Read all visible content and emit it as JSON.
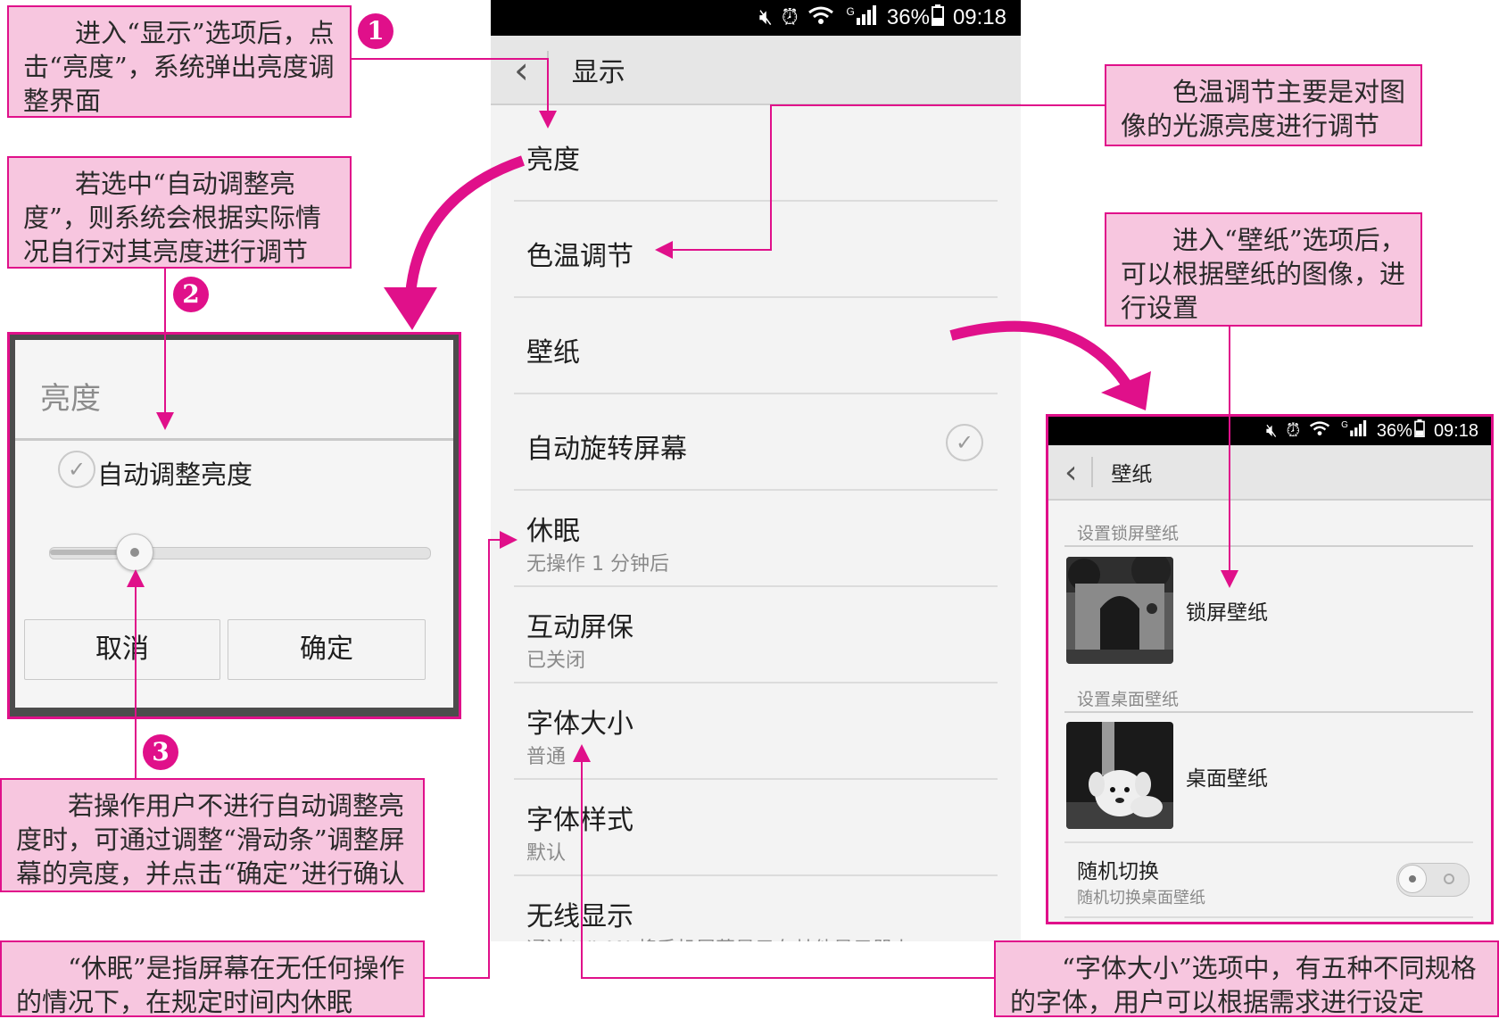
{
  "main_screen": {
    "status_bar": {
      "battery": "36%",
      "time": "09:18",
      "network": "G"
    },
    "title": "显示",
    "items": [
      {
        "title": "亮度"
      },
      {
        "title": "色温调节"
      },
      {
        "title": "壁纸"
      },
      {
        "title": "自动旋转屏幕",
        "checked": true
      },
      {
        "title": "休眠",
        "subtitle": "无操作 1 分钟后"
      },
      {
        "title": "互动屏保",
        "subtitle": "已关闭"
      },
      {
        "title": "字体大小",
        "subtitle": "普通"
      },
      {
        "title": "字体样式",
        "subtitle": "默认"
      },
      {
        "title": "无线显示",
        "subtitle": "通过 WLAN 将手机屏幕显示在其他显示器上"
      }
    ]
  },
  "brightness_dialog": {
    "title": "亮度",
    "auto_label": "自动调整亮度",
    "auto_checked": true,
    "slider_level": 0.22,
    "cancel_label": "取消",
    "confirm_label": "确定"
  },
  "wallpaper_screen": {
    "status_bar": {
      "battery": "36%",
      "time": "09:18",
      "network": "G"
    },
    "title": "壁纸",
    "lock_section": "设置锁屏壁纸",
    "lock_item": "锁屏壁纸",
    "home_section": "设置桌面壁纸",
    "home_item": "桌面壁纸",
    "random_title": "随机切换",
    "random_subtitle": "随机切换桌面壁纸",
    "random_on": false
  },
  "callouts": {
    "c1": {
      "badge": "1",
      "text": "进入“显示”选项后，点击“亮度”，系统弹出亮度调整界面"
    },
    "c2": {
      "badge": "2",
      "text": "若选中“自动调整亮度”，则系统会根据实际情况自行对其亮度进行调节"
    },
    "c3": {
      "badge": "3",
      "text": "若操作用户不进行自动调整亮度时，可通过调整“滑动条”调整屏幕的亮度，并点击“确定”进行确认"
    },
    "color_temp": "色温调节主要是对图像的光源亮度进行调节",
    "wallpaper": "进入“壁纸”选项后，可以根据壁纸的图像，进行设置",
    "sleep": "“休眠”是指屏幕在无任何操作的情况下，在规定时间内休眠",
    "font_size": "“字体大小”选项中，有五种不同规格的字体，用户可以根据需求进行设定"
  },
  "colors": {
    "accent": "#e0108a",
    "callout_bg": "#f7c6df",
    "statusbar": "#000000",
    "actionbar": "#e6e6e6"
  }
}
